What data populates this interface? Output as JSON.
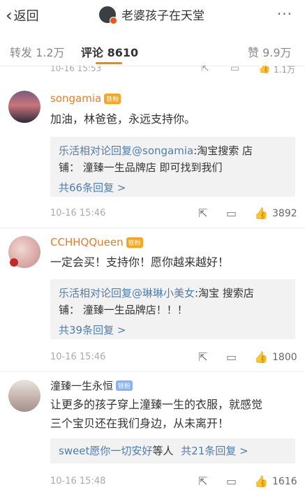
{
  "nav": {
    "back_label": "返回",
    "back_icon": "chevron-left",
    "title": "老婆孩子在天堂",
    "more_label": "···"
  },
  "tabs": {
    "repost": "转发 1.2万",
    "comments": "评论 8610",
    "likes": "赞 9.9万"
  },
  "partial_previous": {
    "time": "10-16 15:53",
    "likes": "1.1万"
  },
  "comments": [
    {
      "name": "songamia",
      "badge": "铁粉",
      "text": "加油，林爸爸，永远支持你。",
      "reply_line1_who": "乐活相对论回复@songamia",
      "reply_line1_rest": ":淘宝搜索 店",
      "reply_line2": "铺： 潼臻一生品牌店  即可找到我们",
      "reply_more": "共66条回复 >",
      "time": "10-16 15:46",
      "likes": "3892"
    },
    {
      "name": "CCHHQQueen",
      "badge": "铁粉",
      "text": "一定会买！支持你！愿你越来越好！",
      "reply_line1_who": "乐活相对论回复@琳琳小美女",
      "reply_line1_rest": ":淘宝 搜索店",
      "reply_line2": "铺： 潼臻一生品牌店！！！",
      "reply_more": "共39条回复 >",
      "time": "10-16 15:46",
      "likes": "1800"
    },
    {
      "name": "潼臻一生永恒",
      "badge": "铁粉",
      "text1": "让更多的孩子穿上潼臻一生的衣服，就感觉",
      "text2": "三个宝贝还在我们身边，从未离开！",
      "reply_who": "sweet愿你一切安好",
      "reply_mid": "等人",
      "reply_more": "共21条回复 >",
      "time": "10-16 15:48",
      "likes": "1616"
    }
  ],
  "colors": {
    "accent": "#ff8200",
    "link": "#507daf",
    "username": "#e67e22"
  }
}
